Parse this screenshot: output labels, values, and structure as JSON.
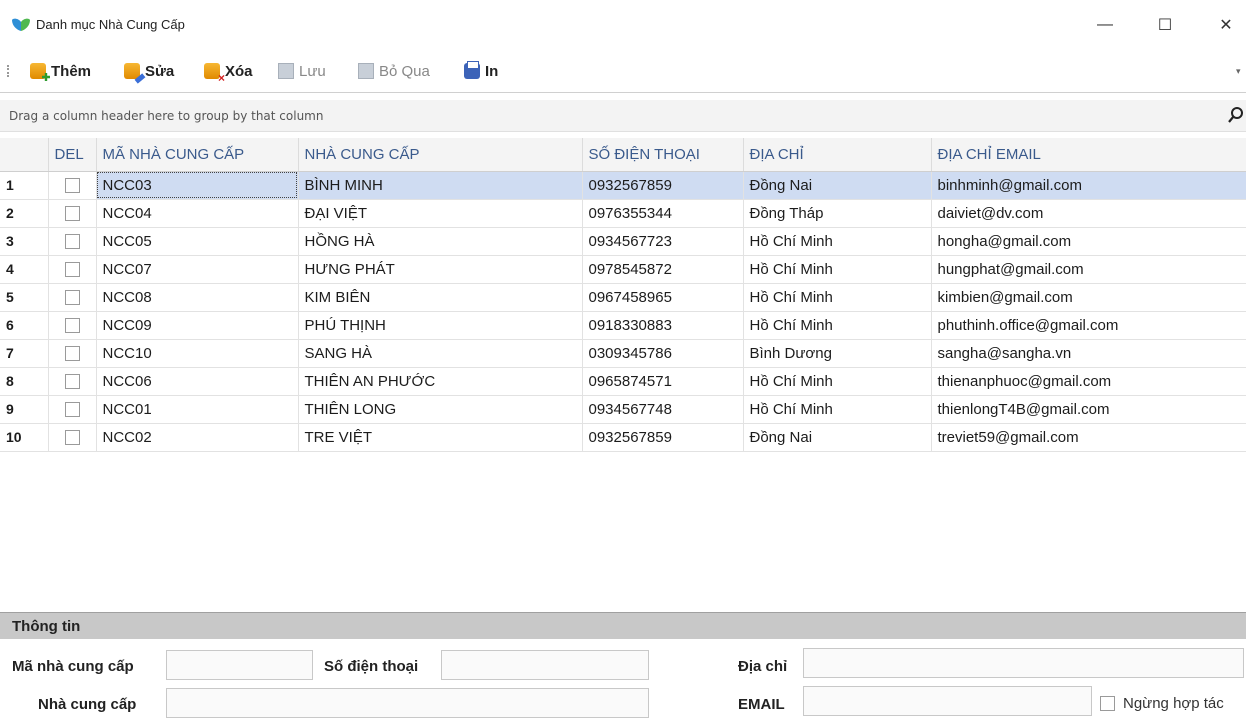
{
  "window": {
    "title": "Danh mục Nhà Cung Cấp",
    "minimize_glyph": "—",
    "maximize_glyph": "☐",
    "close_glyph": "✕"
  },
  "toolbar": {
    "add_label": "Thêm",
    "edit_label": "Sửa",
    "delete_label": "Xóa",
    "save_label": "Lưu",
    "cancel_label": "Bỏ Qua",
    "print_label": "In",
    "overflow_glyph": "▾"
  },
  "grid": {
    "group_hint": "Drag a column header here to group by that column",
    "columns": [
      "",
      "DEL",
      "MÃ NHÀ CUNG CẤP",
      "NHÀ CUNG CẤP",
      "SỐ ĐIỆN THOẠI",
      "ĐỊA CHỈ",
      "ĐỊA CHỈ EMAIL"
    ],
    "rows": [
      {
        "n": "1",
        "del": false,
        "code": "NCC03",
        "name": "BÌNH MINH",
        "phone": "0932567859",
        "address": "Đồng Nai",
        "email": "binhminh@gmail.com"
      },
      {
        "n": "2",
        "del": false,
        "code": "NCC04",
        "name": "ĐẠI VIỆT",
        "phone": "0976355344",
        "address": "Đồng Tháp",
        "email": "daiviet@dv.com"
      },
      {
        "n": "3",
        "del": false,
        "code": "NCC05",
        "name": "HỒNG HÀ",
        "phone": "0934567723",
        "address": "Hồ Chí Minh",
        "email": "hongha@gmail.com"
      },
      {
        "n": "4",
        "del": false,
        "code": "NCC07",
        "name": "HƯNG PHÁT",
        "phone": "0978545872",
        "address": "Hồ Chí Minh",
        "email": "hungphat@gmail.com"
      },
      {
        "n": "5",
        "del": false,
        "code": "NCC08",
        "name": "KIM BIÊN",
        "phone": "0967458965",
        "address": "Hồ Chí Minh",
        "email": "kimbien@gmail.com"
      },
      {
        "n": "6",
        "del": false,
        "code": "NCC09",
        "name": "PHÚ THỊNH",
        "phone": "0918330883",
        "address": "Hồ Chí Minh",
        "email": "phuthinh.office@gmail.com"
      },
      {
        "n": "7",
        "del": false,
        "code": "NCC10",
        "name": "SANG HÀ",
        "phone": "0309345786",
        "address": "Bình Dương",
        "email": "sangha@sangha.vn"
      },
      {
        "n": "8",
        "del": false,
        "code": "NCC06",
        "name": "THIÊN AN PHƯỚC",
        "phone": "0965874571",
        "address": "Hồ Chí Minh",
        "email": "thienanphuoc@gmail.com"
      },
      {
        "n": "9",
        "del": false,
        "code": "NCC01",
        "name": "THIÊN LONG",
        "phone": "0934567748",
        "address": "Hồ Chí Minh",
        "email": "thienlongT4B@gmail.com"
      },
      {
        "n": "10",
        "del": false,
        "code": "NCC02",
        "name": "TRE VIỆT",
        "phone": "0932567859",
        "address": "Đồng Nai",
        "email": "treviet59@gmail.com"
      }
    ],
    "selected_row": 0
  },
  "info": {
    "title": "Thông tin",
    "code_label": "Mã nhà cung cấp",
    "code_value": "",
    "phone_label": "Số điện thoại",
    "phone_value": "",
    "address_label": "Địa chỉ",
    "address_value": "",
    "name_label": "Nhà cung cấp",
    "name_value": "",
    "email_label": "EMAIL",
    "email_value": "",
    "inactive_label": "Ngừng hợp tác"
  },
  "colors": {
    "header_text": "#3a5a8c",
    "selected_row": "#cfdcf2",
    "info_header": "#c8c8c8"
  }
}
